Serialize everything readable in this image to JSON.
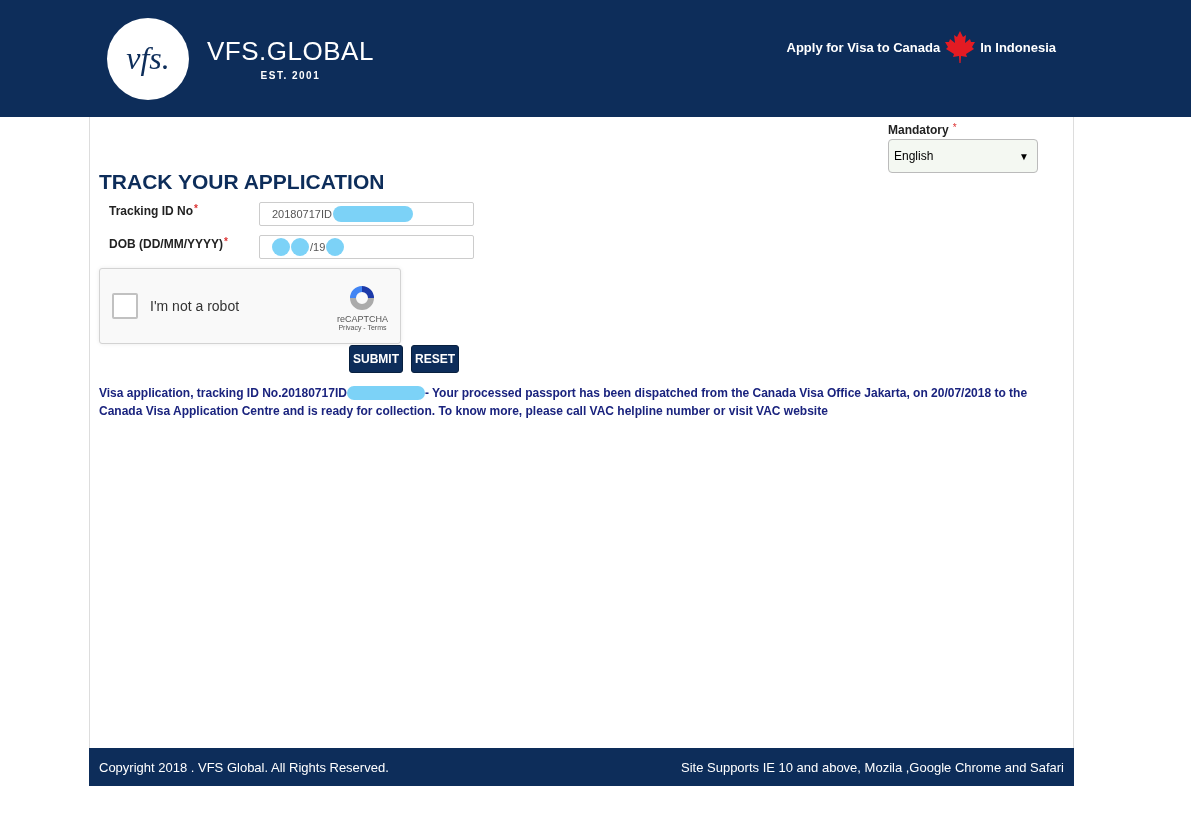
{
  "header": {
    "brand": "VFS.GLOBAL",
    "tagline": "EST. 2001",
    "logo_text": "vfs.",
    "apply_text": "Apply for Visa to Canada",
    "country_text": "In Indonesia"
  },
  "language": {
    "label": "Mandatory",
    "mark": "*",
    "value": "English",
    "caret": "▼"
  },
  "title": "TRACK YOUR APPLICATION",
  "fields": [
    {
      "label": "Tracking ID No",
      "mark": "*",
      "segments": [
        {
          "kind": "text",
          "text": "20180717ID"
        },
        {
          "kind": "redacted"
        }
      ]
    },
    {
      "label": "DOB (DD/MM/YYYY)",
      "mark": "*",
      "segments": [
        {
          "kind": "redacted"
        },
        {
          "kind": "redacted"
        },
        {
          "kind": "text",
          "text": "/19"
        },
        {
          "kind": "redacted"
        }
      ]
    }
  ],
  "captcha": {
    "label": "I'm not a robot",
    "checked": false,
    "brand": "reCAPTCHA",
    "links": "Privacy - Terms"
  },
  "buttons": [
    "SUBMIT",
    "RESET"
  ],
  "message": [
    [
      {
        "kind": "text",
        "text": "Visa application, tracking ID No.20180717ID"
      },
      {
        "kind": "redacted"
      },
      {
        "kind": "text",
        "text": "- Your processed passport has been dispatched from the Canada Visa Office Jakarta, on 20/07/2018 to the"
      }
    ],
    [
      {
        "kind": "text",
        "text": "Canada Visa Application Centre and is ready for collection. To know more, please call VAC helpline number or visit VAC website"
      }
    ]
  ],
  "footer": {
    "copyright": "Copyright 2018 . VFS Global. All Rights Reserved.",
    "support": "Site Supports IE 10 and above, Mozila ,Google Chrome and Safari"
  }
}
